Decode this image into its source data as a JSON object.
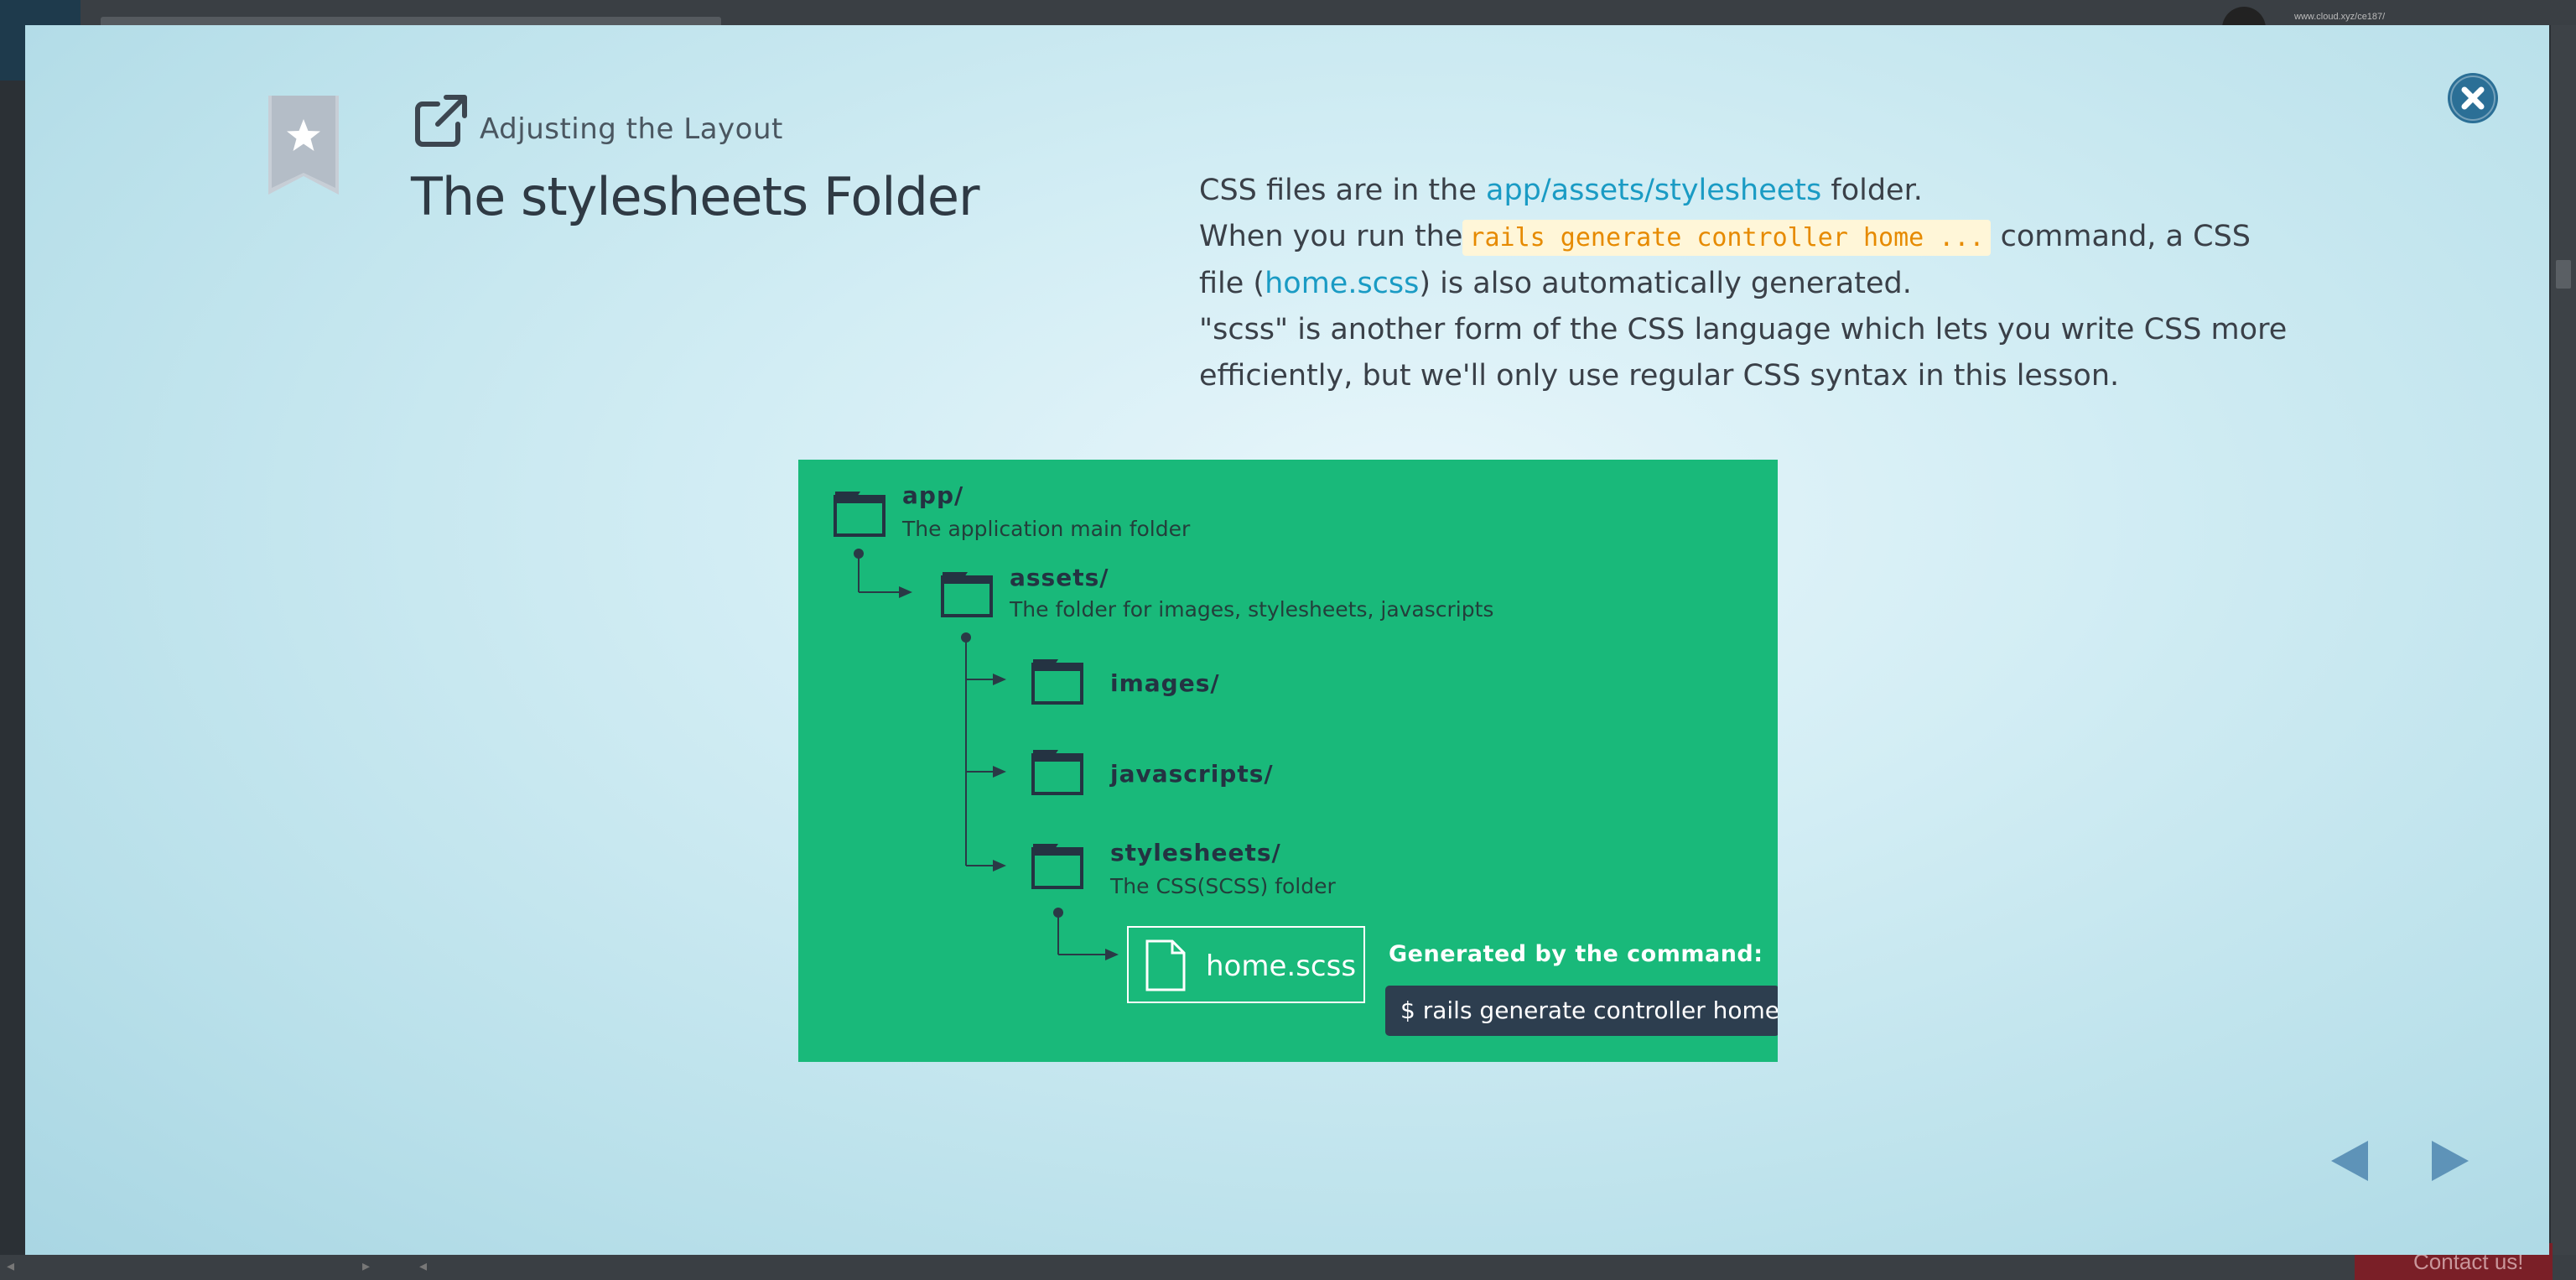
{
  "background": {
    "url_text": "www.cloud.xyz/ce187/",
    "contact_label": "Contact us!"
  },
  "lesson": {
    "subtitle": "Adjusting the Layout",
    "title": "The stylesheets Folder"
  },
  "description": {
    "line1_prefix": "CSS files are in the ",
    "line1_link": "app/assets/stylesheets",
    "line1_suffix": " folder.",
    "line2_prefix": "When you run the",
    "line2_code": "rails generate controller home ...",
    "line2_suffix": " command, a CSS file (",
    "line2_link": "home.scss",
    "line2_end": ") is also automatically generated.",
    "line3": "\"scss\" is another form of the CSS language which lets you write CSS more efficiently, but we'll only use regular CSS syntax in this lesson."
  },
  "diagram": {
    "app_label": "app/",
    "app_desc": "The application main folder",
    "assets_label": "assets/",
    "assets_desc": "The folder for images, stylesheets, javascripts",
    "images_label": "images/",
    "javascripts_label": "javascripts/",
    "stylesheets_label": "stylesheets/",
    "stylesheets_desc": "The CSS(SCSS) folder",
    "file_label": "home.scss",
    "generated_title": "Generated by the command:",
    "command_text": "$ rails generate controller home ..."
  },
  "icons": {
    "bookmark": "bookmark-star-icon",
    "external": "external-link-icon",
    "close": "close-circle-icon",
    "prev": "triangle-left-icon",
    "next": "triangle-right-icon"
  },
  "colors": {
    "accent_link": "#1a9bc4",
    "diagram_bg": "#19b97a",
    "close_btn": "#2b6f96",
    "nav_arrow": "#5e93b8"
  }
}
